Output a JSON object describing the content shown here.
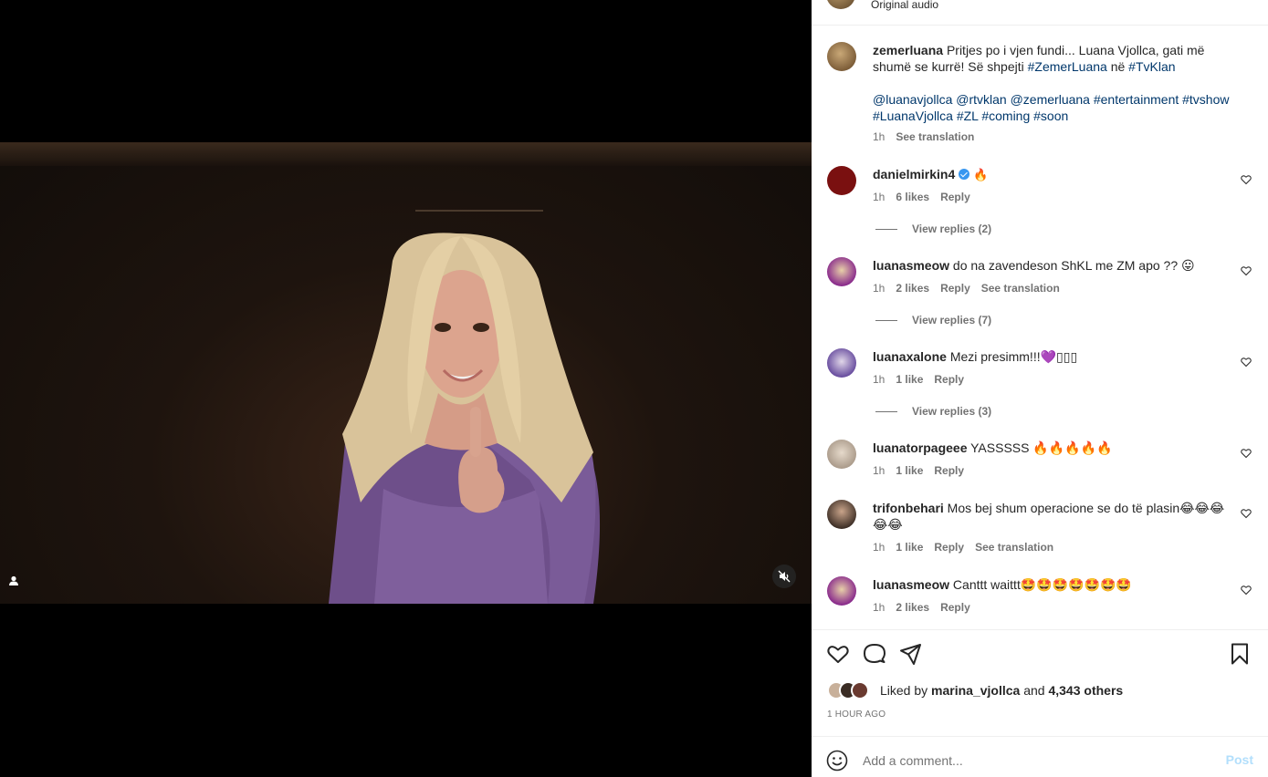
{
  "audio": {
    "label": "Original audio"
  },
  "caption": {
    "username": "zemerluana",
    "text": "Pritjes po i vjen fundi... Luana Vjollca, gati më shumë se kurrë! Së shpejti",
    "tag1": "#ZemerLuana",
    "mid": "në",
    "tag2": "#TvKlan",
    "line2": "@luanavjollca @rtvklan @zemerluana #entertainment #tvshow",
    "line3": "#LuanaVjollca #ZL #coming #soon",
    "time": "1h",
    "see_translation": "See translation"
  },
  "comments": [
    {
      "username": "danielmirkin4",
      "verified": true,
      "text": "🔥",
      "time": "1h",
      "likes": "6 likes",
      "reply": "Reply",
      "view_replies": "View replies (2)",
      "avatar_color": "#7a1010"
    },
    {
      "username": "luanasmeow",
      "text": "do na zavendeson ShKL me ZM apo ?? 😛",
      "time": "1h",
      "likes": "2 likes",
      "reply": "Reply",
      "see_translation": "See translation",
      "view_replies": "View replies (7)",
      "avatar_color": "#8a2c8c"
    },
    {
      "username": "luanaxalone",
      "text": "Mezi presimm!!!💜▯▯▯",
      "time": "1h",
      "likes": "1 like",
      "reply": "Reply",
      "view_replies": "View replies (3)",
      "avatar_color": "#6a4fa0"
    },
    {
      "username": "luanatorpageee",
      "text": "YASSSSS 🔥🔥🔥🔥🔥",
      "time": "1h",
      "likes": "1 like",
      "reply": "Reply",
      "avatar_color": "#c8b8a8"
    },
    {
      "username": "trifonbehari",
      "text": "Mos bej shum operacione se do të plasin😂😂😂",
      "text2": "😂😂",
      "time": "1h",
      "likes": "1 like",
      "reply": "Reply",
      "see_translation": "See translation",
      "avatar_color": "#4a3c34"
    },
    {
      "username": "luanasmeow",
      "text": "Canttt waittt🤩🤩🤩🤩🤩🤩🤩",
      "time": "1h",
      "likes": "2 likes",
      "reply": "Reply",
      "avatar_color": "#8a2c8c"
    }
  ],
  "likes": {
    "prefix": "Liked by",
    "user": "marina_vjollca",
    "and": "and",
    "others": "4,343 others"
  },
  "time_ago": "1 HOUR AGO",
  "add_comment": {
    "placeholder": "Add a comment...",
    "post": "Post"
  },
  "icons": [
    "heart-icon",
    "comment-icon",
    "share-icon",
    "bookmark-icon",
    "emoji-icon",
    "mute-icon",
    "user-tag-icon"
  ],
  "colors": {
    "link": "#00376b",
    "muted": "#737373",
    "post_disabled": "#b2dffc",
    "verified": "#3897f0"
  }
}
